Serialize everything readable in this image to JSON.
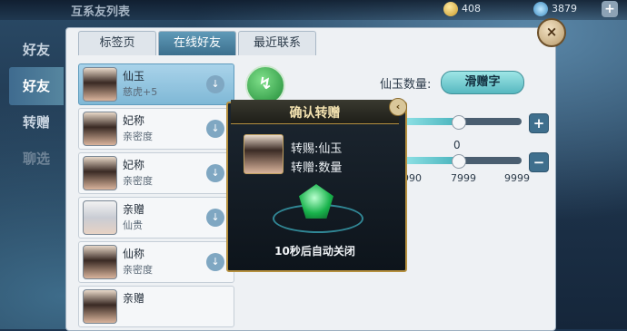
{
  "topbar": {
    "title": "互系友列表",
    "res1": "408",
    "res2": "3879",
    "add": "+"
  },
  "side": [
    "好友",
    "好友",
    "转赠",
    "聊选"
  ],
  "tabs": [
    "标签页",
    "在线好友",
    "最近联系"
  ],
  "friends": [
    {
      "name": "仙玉",
      "sub": "慈虎+5"
    },
    {
      "name": "妃称",
      "sub": "亲密度"
    },
    {
      "name": "妃称",
      "sub": "亲密度"
    },
    {
      "name": "亲赠",
      "sub": "仙贵"
    },
    {
      "name": "仙称",
      "sub": "亲密度"
    },
    {
      "name": "亲赠",
      "sub": ""
    }
  ],
  "amount": {
    "label": "仙玉数量:",
    "button": "滑赠字",
    "value": "0",
    "ticks": [
      "990",
      "7999",
      "9999"
    ]
  },
  "dialog": {
    "title": "确认转赠",
    "line1": "转赐:仙玉",
    "line2": "转赠:数量",
    "footer": "10秒后自动关闭"
  },
  "icons": {
    "close": "×",
    "popup_close": "‹",
    "arrow": "↓",
    "plus": "+",
    "minus": "−"
  }
}
